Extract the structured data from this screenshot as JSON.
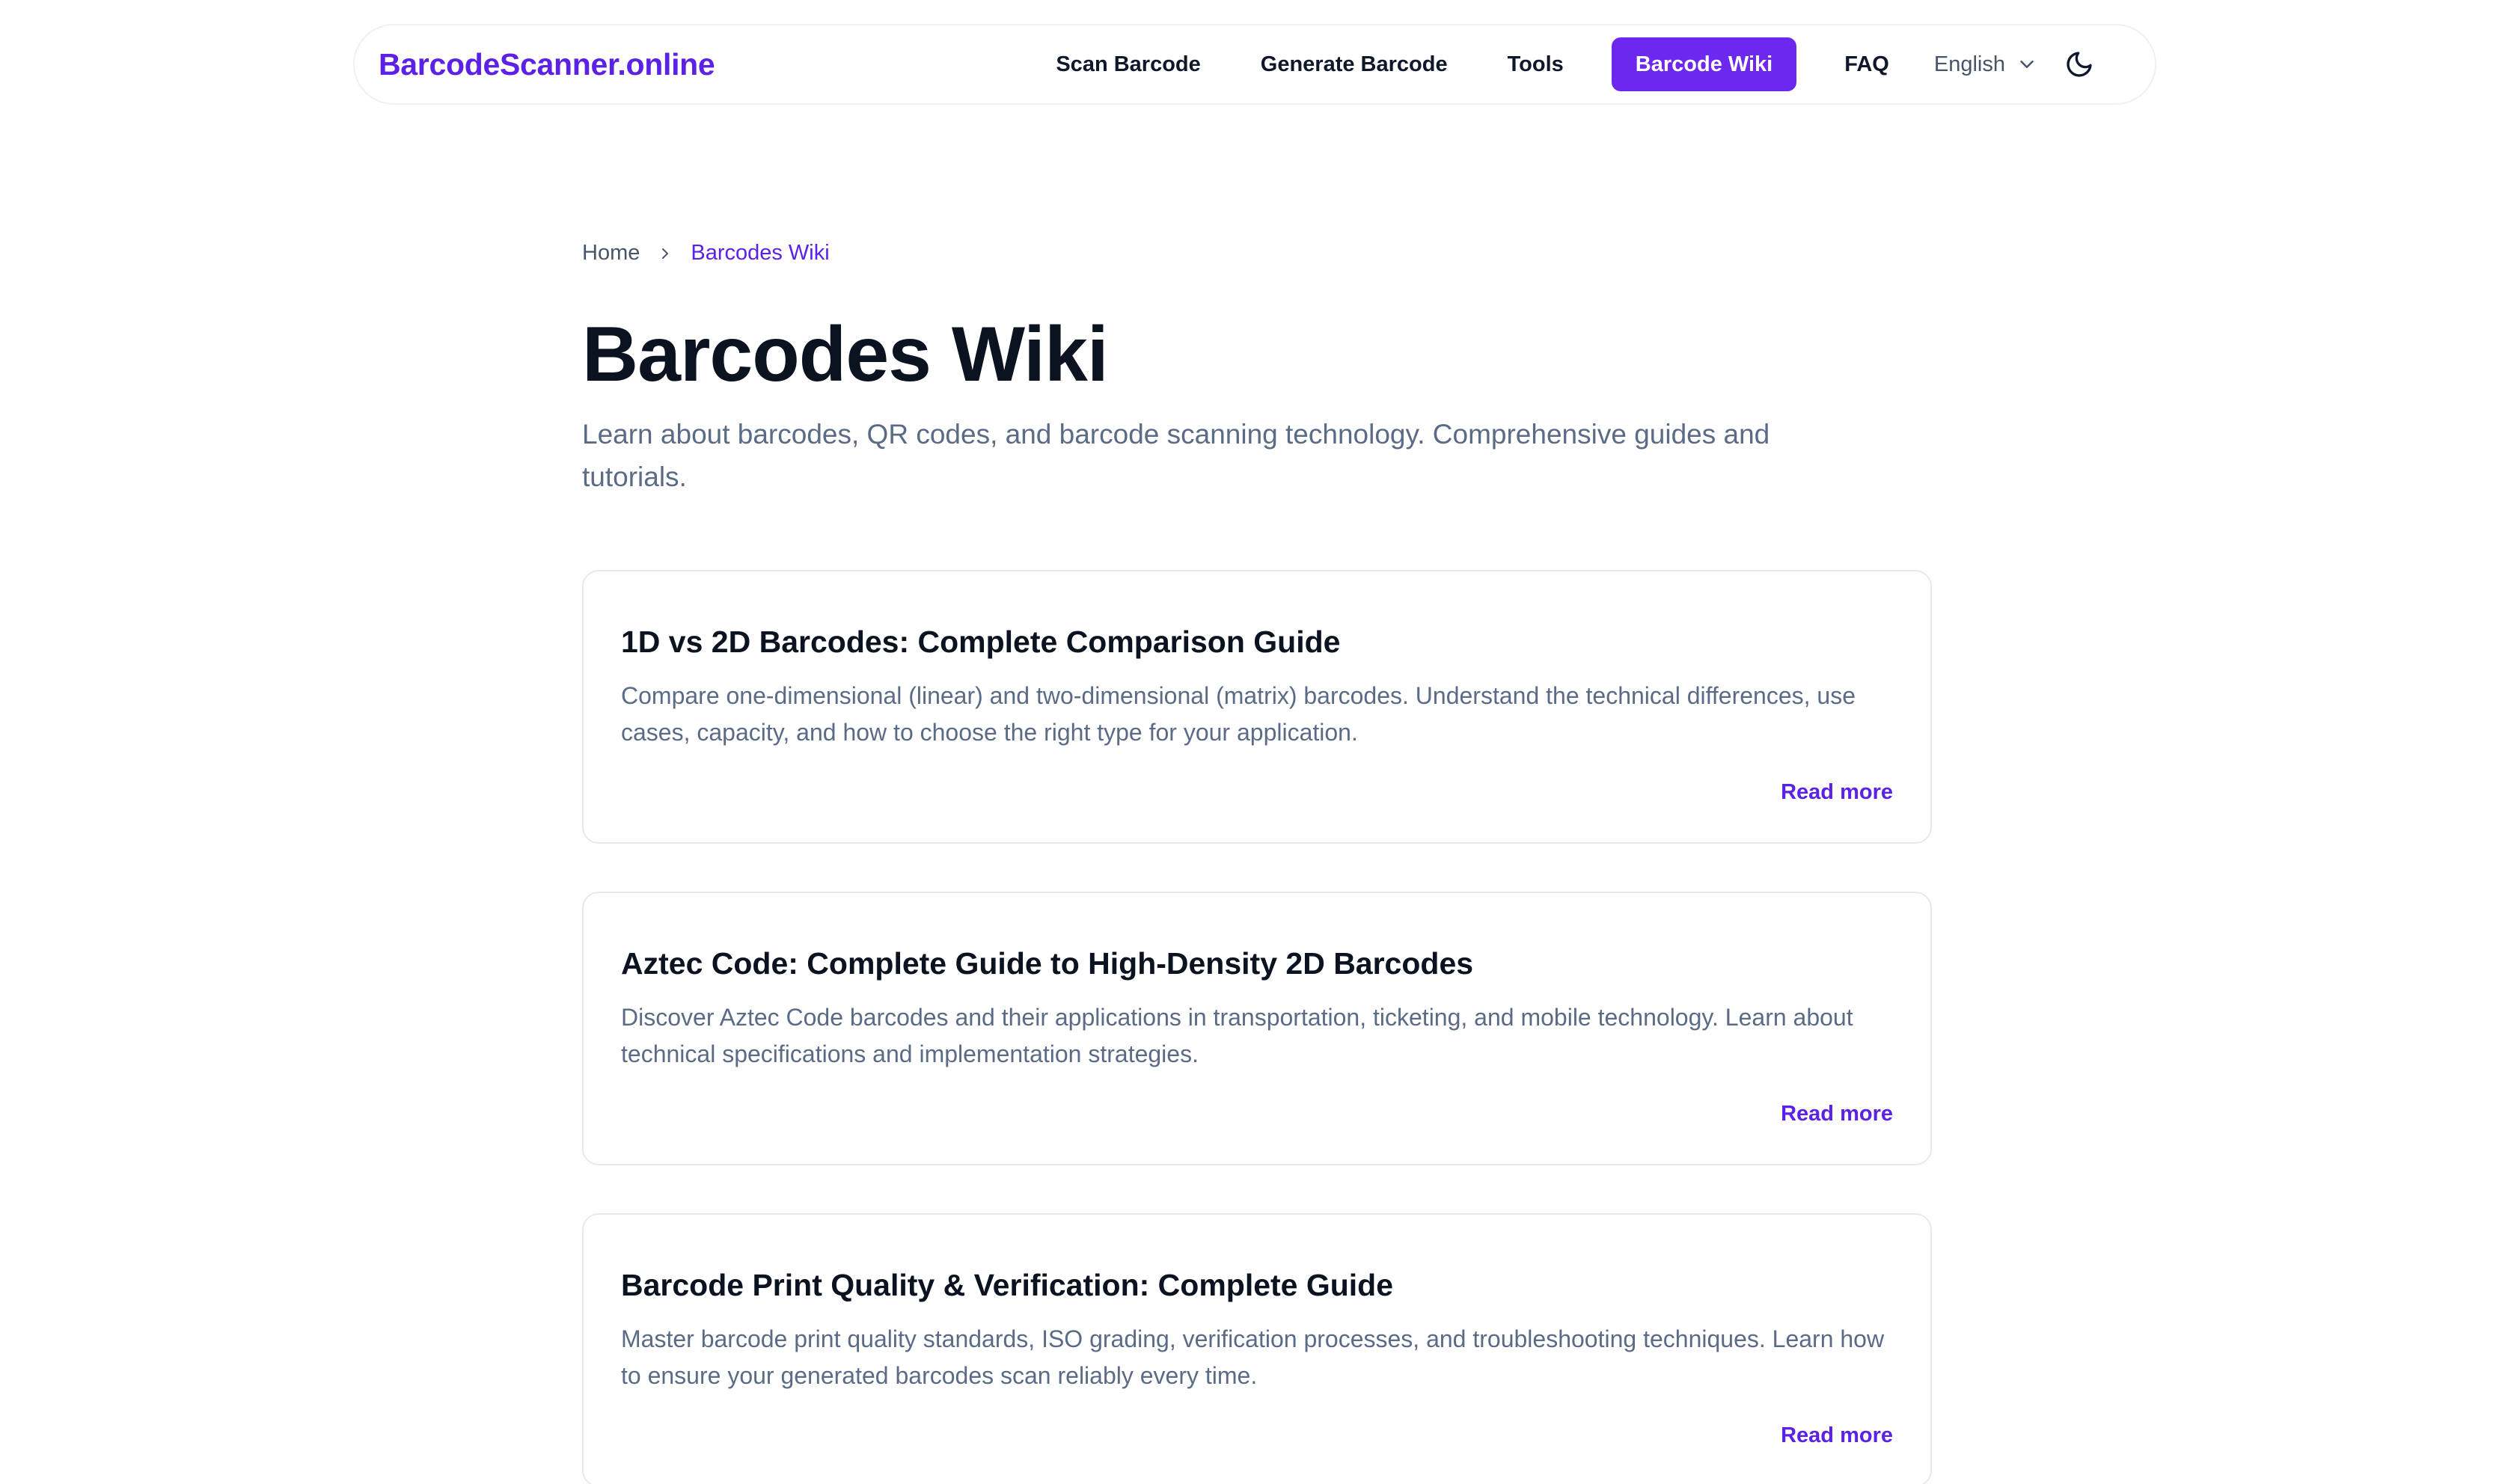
{
  "header": {
    "brand": "BarcodeScanner.online",
    "nav": [
      {
        "label": "Scan Barcode",
        "active": false
      },
      {
        "label": "Generate Barcode",
        "active": false
      },
      {
        "label": "Tools",
        "active": false
      },
      {
        "label": "Barcode Wiki",
        "active": true
      },
      {
        "label": "FAQ",
        "active": false
      }
    ],
    "language": {
      "selected": "English",
      "icon": "chevron-down-icon"
    },
    "theme_toggle_icon": "moon-icon",
    "accent_color": "#6d28f0"
  },
  "breadcrumb": {
    "home": "Home",
    "separator_icon": "chevron-right-icon",
    "current": "Barcodes Wiki"
  },
  "page": {
    "title": "Barcodes Wiki",
    "subtitle": "Learn about barcodes, QR codes, and barcode scanning technology. Comprehensive guides and tutorials."
  },
  "articles": [
    {
      "title": "1D vs 2D Barcodes: Complete Comparison Guide",
      "description": "Compare one-dimensional (linear) and two-dimensional (matrix) barcodes. Understand the technical differences, use cases, capacity, and how to choose the right type for your application.",
      "link_label": "Read more"
    },
    {
      "title": "Aztec Code: Complete Guide to High-Density 2D Barcodes",
      "description": "Discover Aztec Code barcodes and their applications in transportation, ticketing, and mobile technology. Learn about technical specifications and implementation strategies.",
      "link_label": "Read more"
    },
    {
      "title": "Barcode Print Quality & Verification: Complete Guide",
      "description": "Master barcode print quality standards, ISO grading, verification processes, and troubleshooting techniques. Learn how to ensure your generated barcodes scan reliably every time.",
      "link_label": "Read more"
    }
  ]
}
